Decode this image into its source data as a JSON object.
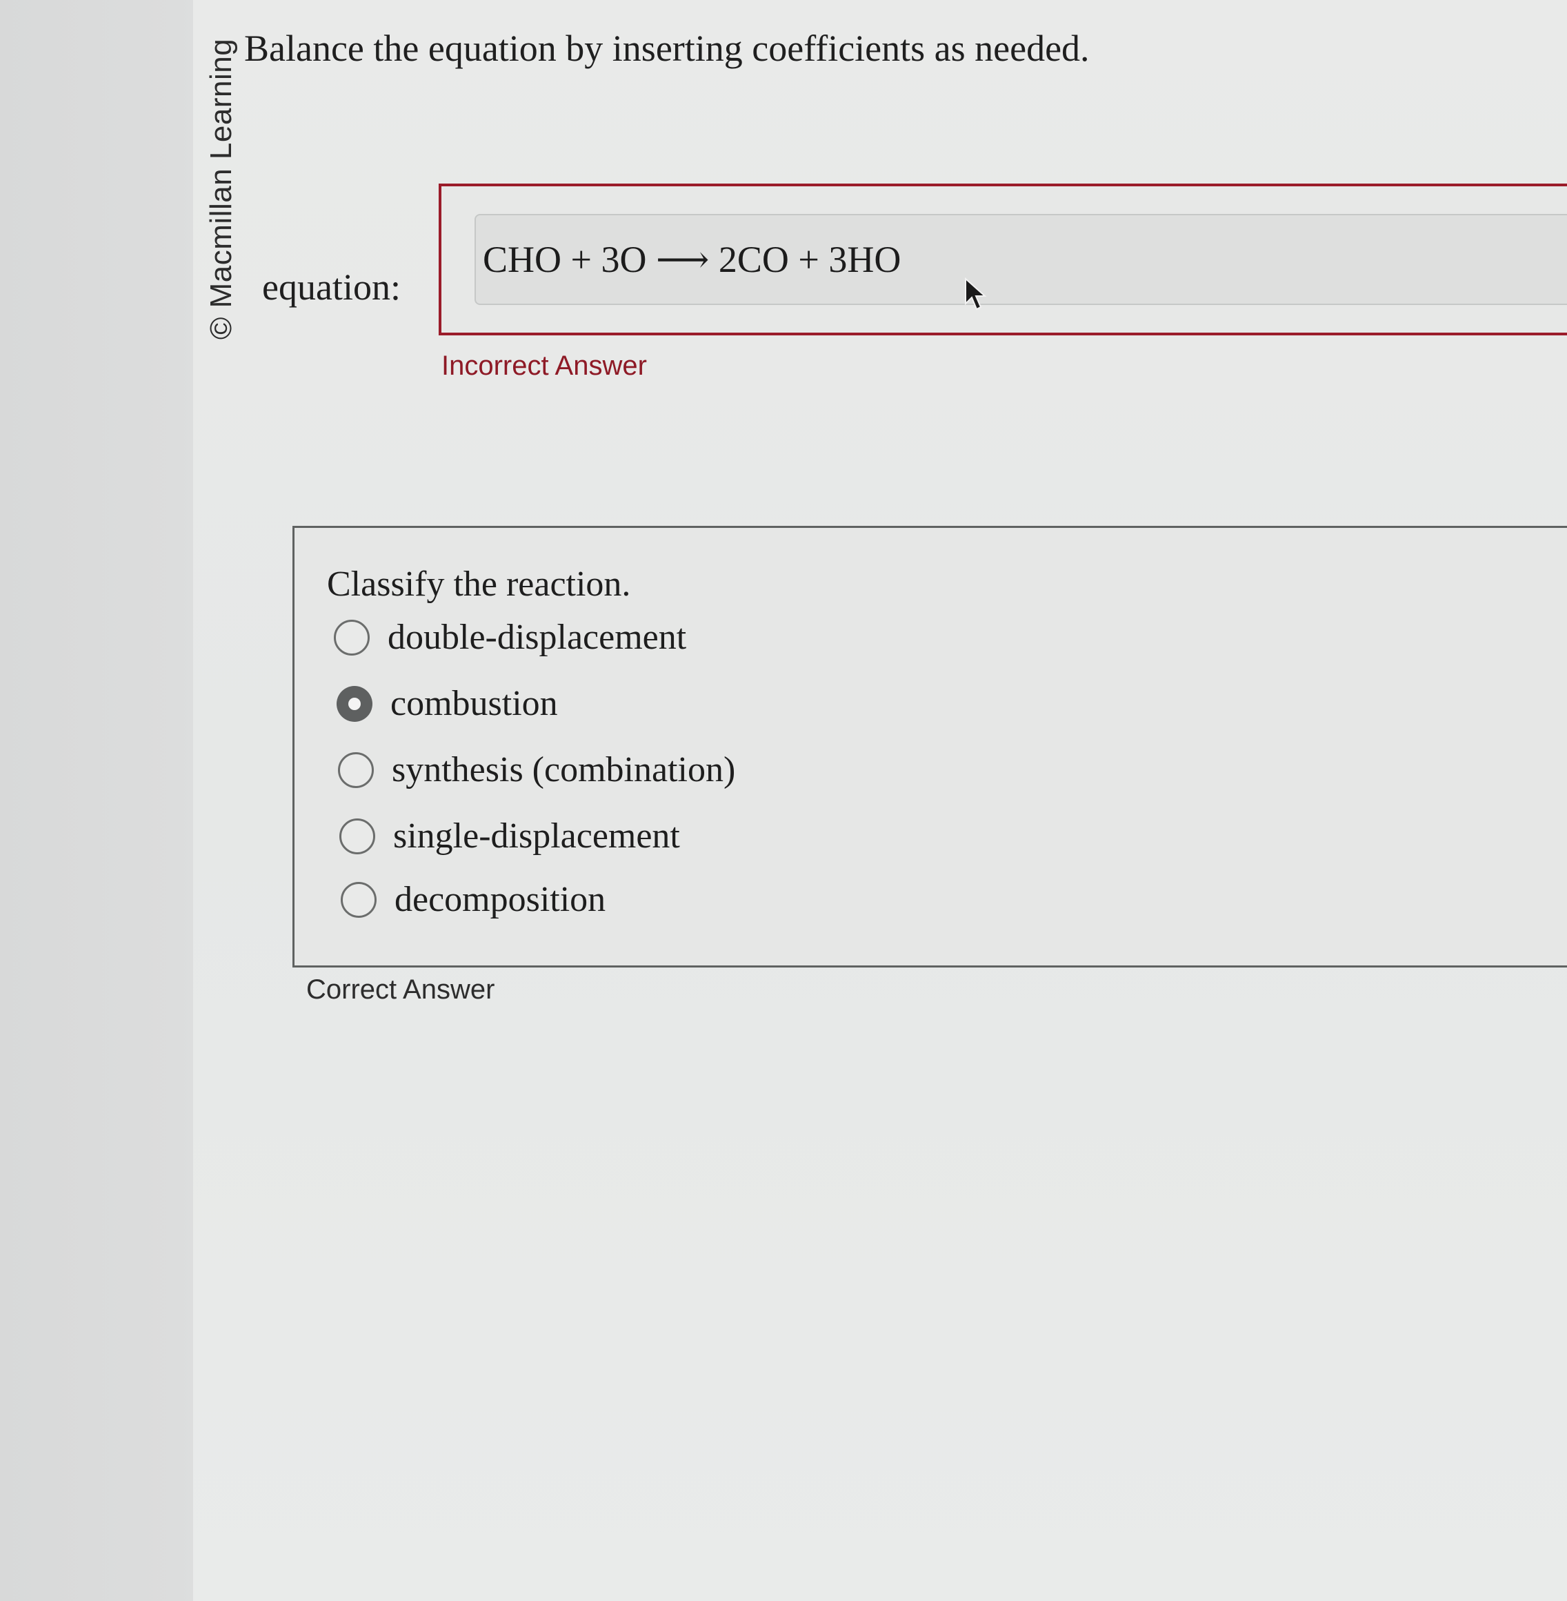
{
  "watermark": "© Macmillan Learning",
  "question": {
    "title": "Balance the equation by inserting coefficients as needed.",
    "equation_label": "equation:",
    "equation_value": "CHO + 3O ⟶ 2CO + 3HO",
    "feedback": "Incorrect Answer"
  },
  "classify": {
    "title": "Classify the reaction.",
    "options": [
      {
        "label": "double-displacement",
        "selected": false
      },
      {
        "label": "combustion",
        "selected": true
      },
      {
        "label": "synthesis (combination)",
        "selected": false
      },
      {
        "label": "single-displacement",
        "selected": false
      },
      {
        "label": "decomposition",
        "selected": false
      }
    ],
    "feedback": "Correct Answer"
  },
  "colors": {
    "incorrect": "#9b1c2a",
    "text": "#1e1e1e"
  },
  "icons": {
    "cursor": "mouse-pointer-icon",
    "radio": "radio-button-icon"
  }
}
